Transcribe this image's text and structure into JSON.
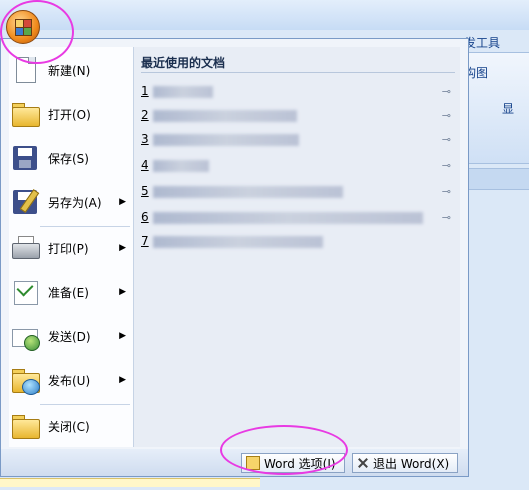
{
  "ribbon": {
    "tab_label": "发工具",
    "group_label": "构图",
    "right_label": "显"
  },
  "menu": {
    "items": [
      {
        "label": "新建(N)",
        "icon": "new-document-icon",
        "submenu": false
      },
      {
        "label": "打开(O)",
        "icon": "open-folder-icon",
        "submenu": false
      },
      {
        "label": "保存(S)",
        "icon": "save-icon",
        "submenu": false
      },
      {
        "label": "另存为(A)",
        "icon": "save-as-icon",
        "submenu": true
      },
      {
        "label": "打印(P)",
        "icon": "printer-icon",
        "submenu": true
      },
      {
        "label": "准备(E)",
        "icon": "prepare-icon",
        "submenu": true
      },
      {
        "label": "发送(D)",
        "icon": "send-icon",
        "submenu": true
      },
      {
        "label": "发布(U)",
        "icon": "publish-icon",
        "submenu": true
      },
      {
        "label": "关闭(C)",
        "icon": "close-folder-icon",
        "submenu": false
      }
    ],
    "submenu_arrow": "▶"
  },
  "recent": {
    "title": "最近使用的文档",
    "pin_glyph": "⊸",
    "items": [
      {
        "num": "1"
      },
      {
        "num": "2"
      },
      {
        "num": "3"
      },
      {
        "num": "4"
      },
      {
        "num": "5"
      },
      {
        "num": "6"
      },
      {
        "num": "7"
      }
    ]
  },
  "footer": {
    "options_label": "Word 选项(I)",
    "exit_label": "退出 Word(X)"
  },
  "colors": {
    "annotation": "#e83ae3",
    "menu_border": "#7a9ac6"
  }
}
